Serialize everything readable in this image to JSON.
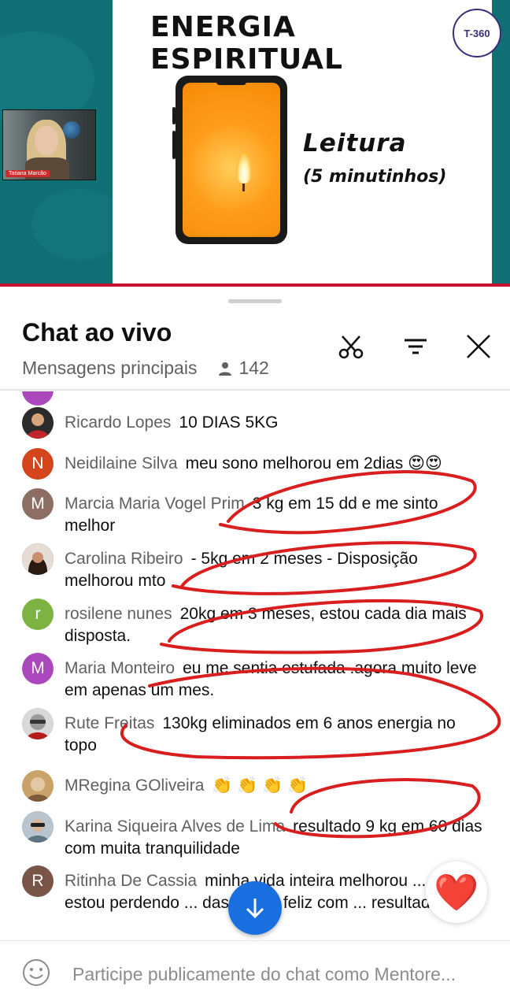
{
  "video": {
    "presenter_name": "Tatiana Marcão",
    "slide_title": "ENERGIA ESPIRITUAL",
    "logo_text": "T-360",
    "slide_line1": "Leitura",
    "slide_line2": "(5 minutinhos)"
  },
  "chat": {
    "title": "Chat ao vivo",
    "mode": "Mensagens principais",
    "viewer_count": "142",
    "messages": [
      {
        "author": "Ricardo Lopes",
        "text": "10 DIAS 5KG",
        "avatar_letter": "",
        "avatar_color": "#b83030"
      },
      {
        "author": "Neidilaine Silva",
        "text": "meu sono melhorou em 2dias 😍😍",
        "avatar_letter": "N",
        "avatar_color": "#d4451c"
      },
      {
        "author": "Marcia Maria Vogel Prim",
        "text": "3 kg em 15 dd e me sinto melhor",
        "avatar_letter": "M",
        "avatar_color": "#8d6e63"
      },
      {
        "author": "Carolina Ribeiro",
        "text": "- 5kg em 2 meses - Disposição melhorou mto",
        "avatar_letter": "",
        "avatar_color": "#3b2a22"
      },
      {
        "author": "rosilene nunes",
        "text": "20kg em 3 meses, estou cada dia mais disposta.",
        "avatar_letter": "r",
        "avatar_color": "#7cb342"
      },
      {
        "author": "Maria Monteiro",
        "text": "eu me sentia estufada .agora muito leve em apenas um mes.",
        "avatar_letter": "M",
        "avatar_color": "#ab47bc"
      },
      {
        "author": "Rute Freitas",
        "text": "130kg eliminados em 6 anos energia no topo",
        "avatar_letter": "",
        "avatar_color": "#9e9e9e"
      },
      {
        "author": "MRegina GOliveira",
        "text": "👏 👏 👏 👏",
        "avatar_letter": "",
        "avatar_color": "#c9a46a"
      },
      {
        "author": "Karina Siqueira Alves de Lima",
        "text": "resultado 9 kg em 60 dias com muita tranquilidade",
        "avatar_letter": "",
        "avatar_color": "#8aa0ad"
      },
      {
        "author": "Ritinha De Cassia",
        "text": "minha vida inteira melhorou ... peso. estou perdendo ... das, muito feliz com ... resultado",
        "avatar_letter": "R",
        "avatar_color": "#795548"
      }
    ],
    "input_placeholder": "Participe publicamente do chat como Mentore...",
    "heart_emoji": "❤️"
  },
  "icons": {
    "clip": "scissors-icon",
    "filter": "filter-icon",
    "close": "close-icon",
    "viewers": "person-icon",
    "scroll": "arrow-down-icon",
    "emoji": "smiley-icon"
  },
  "colors": {
    "video_bg": "#0f6f74",
    "accent_red": "#c8102e",
    "annotation_red": "#d81e1e",
    "scroll_button": "#1a6fe0",
    "author_gray": "#606060"
  }
}
